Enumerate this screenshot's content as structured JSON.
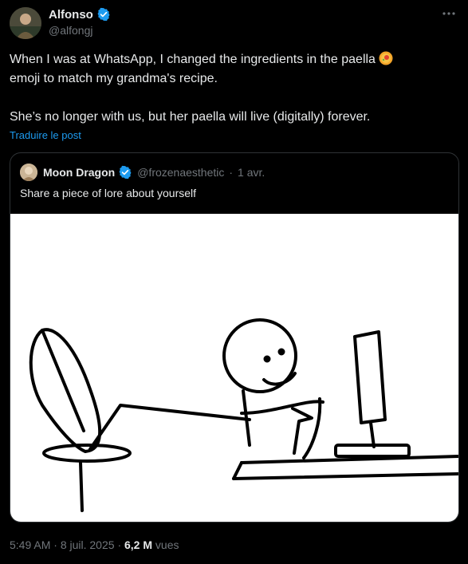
{
  "author": {
    "name": "Alfonso",
    "handle": "@alfongj",
    "verified": true,
    "verified_color": "#1d9bf0",
    "avatar_icon": "profile-photo"
  },
  "more_icon": "ellipsis-icon",
  "tweet": {
    "line1": "When I was at WhatsApp, I changed the ingredients in the paella",
    "line1_icon": "paella-emoji",
    "line2": "emoji to match my grandma's recipe.",
    "paragraph2": "She’s no longer with us, but her paella will live (digitally) forever.",
    "translate_link": "Traduire le post"
  },
  "quote": {
    "name": "Moon Dragon",
    "handle": "@frozenaesthetic",
    "separator": "·",
    "date": "1 avr.",
    "text": "Share a piece of lore about yourself",
    "image": "stick-figure-at-computer"
  },
  "meta": {
    "time": "5:49 AM",
    "separator1": "·",
    "date": "8 juil. 2025",
    "separator2": "·",
    "views_count": "6,2 M",
    "views_label": "vues"
  }
}
